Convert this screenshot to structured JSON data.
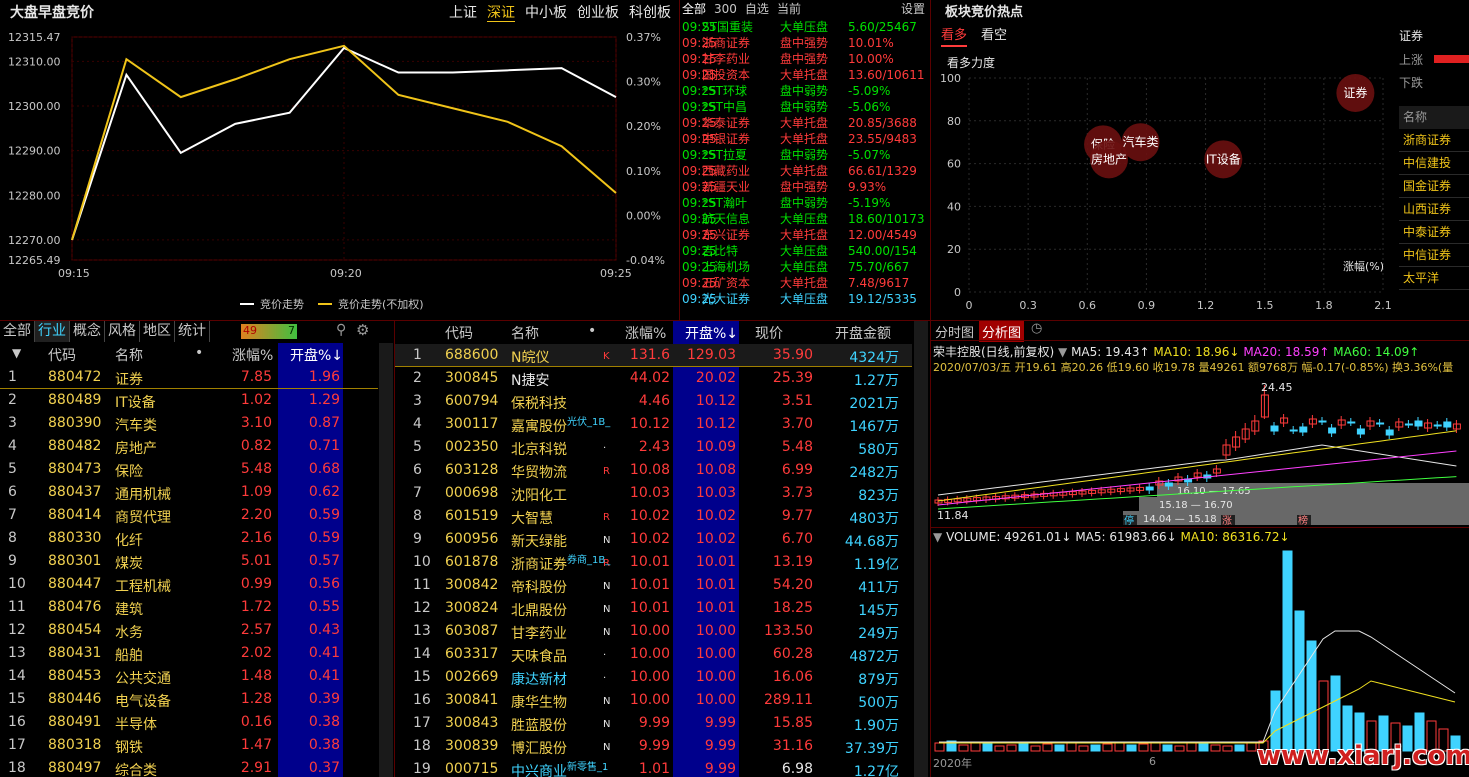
{
  "auction": {
    "title": "大盘早盘竞价",
    "tabs": [
      "上证",
      "深证",
      "中小板",
      "创业板",
      "科创板"
    ],
    "active_tab": "深证",
    "y_left_labels": [
      "12315.47",
      "12310.00",
      "12300.00",
      "12290.00",
      "12280.00",
      "12270.00",
      "12265.49"
    ],
    "y_right_labels": [
      "0.37%",
      "0.30%",
      "0.20%",
      "0.10%",
      "0.00%",
      "-0.04%"
    ],
    "x_labels": [
      "09:15",
      "09:20",
      "09:25"
    ],
    "legend": [
      "竞价走势",
      "竞价走势(不加权)"
    ],
    "colors": {
      "weighted": "#ffffff",
      "unweighted": "#f0c419"
    }
  },
  "chart_data": {
    "type": "line",
    "x": [
      "09:15",
      "09:16",
      "09:17",
      "09:18",
      "09:19",
      "09:20",
      "09:21",
      "09:22",
      "09:23",
      "09:24",
      "09:25"
    ],
    "series": [
      {
        "name": "竞价走势",
        "values": [
          12270.0,
          12307.0,
          12289.5,
          12296.0,
          12298.5,
          12313.0,
          12307.5,
          12307.5,
          12308.0,
          12308.5,
          12302.0
        ]
      },
      {
        "name": "竞价走势(不加权)",
        "values": [
          12270.0,
          12310.5,
          12302.0,
          12306.0,
          12310.5,
          12313.5,
          12302.5,
          12299.5,
          12296.5,
          12291.0,
          12280.5
        ]
      }
    ],
    "ylim": [
      12265.49,
      12315.47
    ]
  },
  "events": {
    "tabs": [
      "全部",
      "300",
      "自选",
      "当前"
    ],
    "settings": "设置",
    "rows": [
      {
        "t": "09:25",
        "name": "ST国重装",
        "type": "大单压盘",
        "val": "5.60/25467",
        "c": "grn"
      },
      {
        "t": "09:25",
        "name": "浙商证券",
        "type": "盘中强势",
        "val": "10.01%",
        "c": "red"
      },
      {
        "t": "09:25",
        "name": "甘李药业",
        "type": "盘中强势",
        "val": "10.00%",
        "c": "red"
      },
      {
        "t": "09:25",
        "name": "国投资本",
        "type": "大单托盘",
        "val": "13.60/10611",
        "c": "red"
      },
      {
        "t": "09:25",
        "name": "*ST环球",
        "type": "盘中弱势",
        "val": "-5.09%",
        "c": "grn"
      },
      {
        "t": "09:25",
        "name": "*ST中昌",
        "type": "盘中弱势",
        "val": "-5.06%",
        "c": "grn"
      },
      {
        "t": "09:25",
        "name": "华泰证券",
        "type": "大单托盘",
        "val": "20.85/3688",
        "c": "red"
      },
      {
        "t": "09:25",
        "name": "中银证券",
        "type": "大单托盘",
        "val": "23.55/9483",
        "c": "red"
      },
      {
        "t": "09:25",
        "name": "*ST拉夏",
        "type": "盘中弱势",
        "val": "-5.07%",
        "c": "grn"
      },
      {
        "t": "09:25",
        "name": "西藏药业",
        "type": "大单托盘",
        "val": "66.61/1329",
        "c": "red"
      },
      {
        "t": "09:25",
        "name": "新疆天业",
        "type": "盘中强势",
        "val": "9.93%",
        "c": "red"
      },
      {
        "t": "09:25",
        "name": "*ST瀚叶",
        "type": "盘中弱势",
        "val": "-5.19%",
        "c": "grn"
      },
      {
        "t": "09:25",
        "name": "航天信息",
        "type": "大单压盘",
        "val": "18.60/10173",
        "c": "grn"
      },
      {
        "t": "09:25",
        "name": "东兴证券",
        "type": "大单托盘",
        "val": "12.00/4549",
        "c": "red"
      },
      {
        "t": "09:25",
        "name": "吉比特",
        "type": "大单压盘",
        "val": "540.00/154",
        "c": "grn"
      },
      {
        "t": "09:25",
        "name": "上海机场",
        "type": "大单压盘",
        "val": "75.70/667",
        "c": "grn"
      },
      {
        "t": "09:25",
        "name": "五矿资本",
        "type": "大单托盘",
        "val": "7.48/9617",
        "c": "red"
      },
      {
        "t": "09:25",
        "name": "光大证券",
        "type": "大单压盘",
        "val": "19.12/5335",
        "c": "cya"
      }
    ]
  },
  "hot": {
    "title": "板块竞价热点",
    "tabs": [
      "看多",
      "看空"
    ],
    "ylabel": "看多力度",
    "xlabel": "涨幅(%)",
    "y_ticks": [
      "100",
      "80",
      "60",
      "40",
      "20",
      "0"
    ],
    "x_ticks": [
      "0",
      "0.3",
      "0.6",
      "0.9",
      "1.2",
      "1.5",
      "1.8",
      "2.1"
    ],
    "bubbles": [
      {
        "label": "证券",
        "x": 1.96,
        "y": 93
      },
      {
        "label": "保险",
        "x": 0.68,
        "y": 69
      },
      {
        "label": "汽车类",
        "x": 0.87,
        "y": 70
      },
      {
        "label": "房地产",
        "x": 0.71,
        "y": 62
      },
      {
        "label": "IT设备",
        "x": 1.29,
        "y": 62
      }
    ],
    "side_title": "证券",
    "side_up": "上涨",
    "side_down": "下跌",
    "side_header": "名称",
    "side_items": [
      "浙商证券",
      "中信建投",
      "国金证券",
      "山西证券",
      "中泰证券",
      "中信证券",
      "太平洋"
    ]
  },
  "sector": {
    "tabs": [
      "全部",
      "行业",
      "概念",
      "风格",
      "地区",
      "统计"
    ],
    "badge_red": "49",
    "badge_green": "7",
    "headers": [
      "代码",
      "名称",
      "•",
      "涨幅%",
      "开盘%↓"
    ],
    "rows": [
      [
        "1",
        "880472",
        "证券",
        "7.85",
        "1.96"
      ],
      [
        "2",
        "880489",
        "IT设备",
        "1.02",
        "1.29"
      ],
      [
        "3",
        "880390",
        "汽车类",
        "3.10",
        "0.87"
      ],
      [
        "4",
        "880482",
        "房地产",
        "0.82",
        "0.71"
      ],
      [
        "5",
        "880473",
        "保险",
        "5.48",
        "0.68"
      ],
      [
        "6",
        "880437",
        "通用机械",
        "1.09",
        "0.62"
      ],
      [
        "7",
        "880414",
        "商贸代理",
        "2.20",
        "0.59"
      ],
      [
        "8",
        "880330",
        "化纤",
        "2.16",
        "0.59"
      ],
      [
        "9",
        "880301",
        "煤炭",
        "5.01",
        "0.57"
      ],
      [
        "10",
        "880447",
        "工程机械",
        "0.99",
        "0.56"
      ],
      [
        "11",
        "880476",
        "建筑",
        "1.72",
        "0.55"
      ],
      [
        "12",
        "880454",
        "水务",
        "2.57",
        "0.43"
      ],
      [
        "13",
        "880431",
        "船舶",
        "2.02",
        "0.41"
      ],
      [
        "14",
        "880453",
        "公共交通",
        "1.48",
        "0.41"
      ],
      [
        "15",
        "880446",
        "电气设备",
        "1.28",
        "0.39"
      ],
      [
        "16",
        "880491",
        "半导体",
        "0.16",
        "0.38"
      ],
      [
        "17",
        "880318",
        "钢铁",
        "1.47",
        "0.38"
      ],
      [
        "18",
        "880497",
        "综合类",
        "2.91",
        "0.37"
      ]
    ]
  },
  "stocks": {
    "headers": [
      "代码",
      "名称",
      "•",
      "涨幅%",
      "开盘%↓",
      "现价",
      "开盘金额"
    ],
    "rows": [
      [
        "1",
        "688600",
        "N皖仪",
        "K",
        "131.6",
        "129.03",
        "35.90",
        "4324万",
        ""
      ],
      [
        "2",
        "300845",
        "N捷安",
        "",
        "44.02",
        "20.02",
        "25.39",
        "1.27万",
        ""
      ],
      [
        "3",
        "600794",
        "保税科技",
        "",
        "4.46",
        "10.12",
        "3.51",
        "2021万",
        ""
      ],
      [
        "4",
        "300117",
        "嘉寓股份",
        "",
        "10.12",
        "10.12",
        "3.70",
        "1467万",
        "光伏_1B_"
      ],
      [
        "5",
        "002350",
        "北京科锐",
        "·",
        "2.43",
        "10.09",
        "5.48",
        "580万",
        ""
      ],
      [
        "6",
        "603128",
        "华贸物流",
        "R",
        "10.08",
        "10.08",
        "6.99",
        "2482万",
        ""
      ],
      [
        "7",
        "000698",
        "沈阳化工",
        "",
        "10.03",
        "10.03",
        "3.73",
        "823万",
        ""
      ],
      [
        "8",
        "601519",
        "大智慧",
        "R",
        "10.02",
        "10.02",
        "9.77",
        "4803万",
        ""
      ],
      [
        "9",
        "600956",
        "新天绿能",
        "N",
        "10.02",
        "10.02",
        "6.70",
        "44.68万",
        ""
      ],
      [
        "10",
        "601878",
        "浙商证券",
        "R",
        "10.01",
        "10.01",
        "13.19",
        "1.19亿",
        "券商_1B_"
      ],
      [
        "11",
        "300842",
        "帝科股份",
        "N",
        "10.01",
        "10.01",
        "54.20",
        "411万",
        ""
      ],
      [
        "12",
        "300824",
        "北鼎股份",
        "N",
        "10.01",
        "10.01",
        "18.25",
        "145万",
        ""
      ],
      [
        "13",
        "603087",
        "甘李药业",
        "N",
        "10.00",
        "10.00",
        "133.50",
        "249万",
        ""
      ],
      [
        "14",
        "603317",
        "天味食品",
        "·",
        "10.00",
        "10.00",
        "60.28",
        "4872万",
        ""
      ],
      [
        "15",
        "002669",
        "康达新材",
        "·",
        "10.00",
        "10.00",
        "16.06",
        "879万",
        ""
      ],
      [
        "16",
        "300841",
        "康华生物",
        "N",
        "10.00",
        "10.00",
        "289.11",
        "500万",
        ""
      ],
      [
        "17",
        "300843",
        "胜蓝股份",
        "N",
        "9.99",
        "9.99",
        "15.85",
        "1.90万",
        ""
      ],
      [
        "18",
        "300839",
        "博汇股份",
        "N",
        "9.99",
        "9.99",
        "31.16",
        "37.39万",
        ""
      ],
      [
        "19",
        "000715",
        "中兴商业",
        "·",
        "1.01",
        "9.99",
        "6.98",
        "1.27亿",
        "新零售_1"
      ]
    ]
  },
  "kline": {
    "tabs": [
      "分时图",
      "分析图"
    ],
    "name": "荣丰控股(日线,前复权)",
    "ma5": "MA5: 19.43↑",
    "ma10": "MA10: 18.96↓",
    "ma20": "MA20: 18.59↑",
    "ma60": "MA60: 14.09↑",
    "info": "2020/07/03/五 开19.61 高20.26 低19.60 收19.78 量49261 额9768万 幅-0.17(-0.85%) 换3.36%(量",
    "high_label": "24.45",
    "low_label": "11.84",
    "band1": "16.10 — 17.65",
    "band2": "15.18 — 16.70",
    "band3": "14.04 — 15.18",
    "markers": [
      "停",
      "涨",
      "榜"
    ],
    "vol": "VOLUME: 49261.01↓",
    "vol_ma5": "MA5: 61983.66↓",
    "vol_ma10": "MA10: 86316.72↓",
    "date_label": "2020年",
    "month_label": "6",
    "watermark": "www.xiarj.com"
  }
}
